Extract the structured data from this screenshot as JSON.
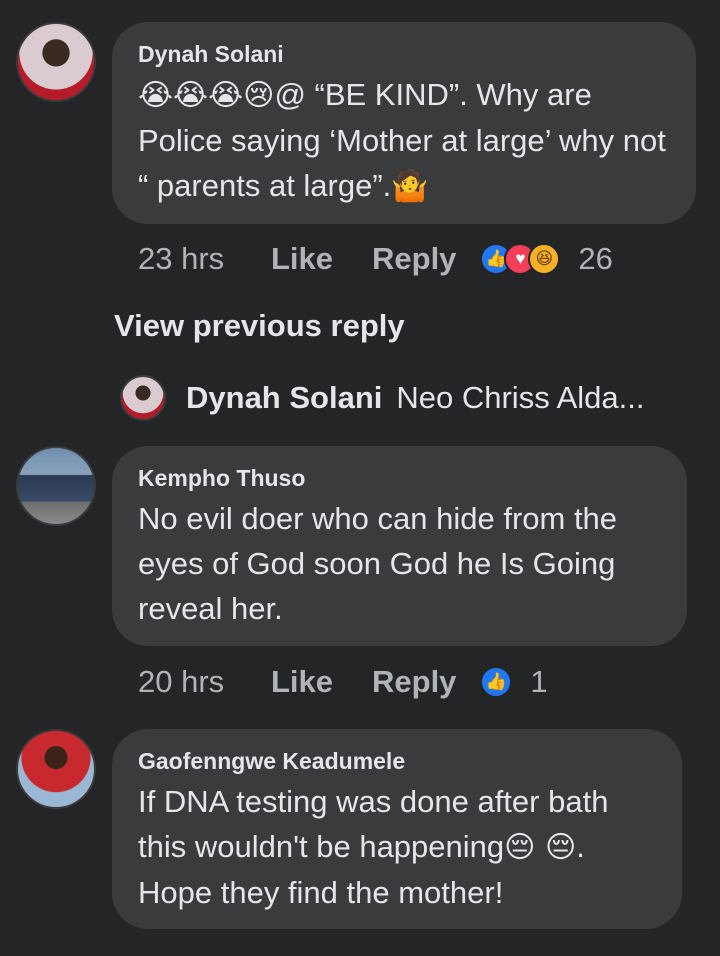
{
  "comments": [
    {
      "author": "Dynah Solani",
      "emojis": "😭😭😭😢",
      "text": "@ “BE KIND”. Why are Police saying  ‘Mother at large’ why not “ parents at large”.",
      "trailing_emoji": "🤷",
      "time": "23 hrs",
      "like_label": "Like",
      "reply_label": "Reply",
      "reaction_count": "26",
      "reactions": [
        "like-icon",
        "love-icon",
        "haha-icon"
      ]
    },
    {
      "author": "Kempho Thuso",
      "text": "No evil doer who can hide from the eyes of God soon God he Is Going reveal her.",
      "time": "20 hrs",
      "like_label": "Like",
      "reply_label": "Reply",
      "reaction_count": "1",
      "reactions": [
        "like-icon"
      ]
    },
    {
      "author": "Gaofenngwe Keadumele",
      "text_line1": "If DNA testing was done after bath this wouldn't be happening",
      "emojis": "😔 😔",
      "text_line2": ". Hope they find the mother!",
      "time": "",
      "reaction_count": ""
    }
  ],
  "view_previous_reply": "View previous reply",
  "reply_preview": {
    "author": "Dynah Solani",
    "snippet": "Neo Chriss Alda..."
  },
  "colors": {
    "background": "#242526",
    "bubble": "#3a3b3c",
    "text": "#e4e6eb",
    "secondary": "#b0b3b8",
    "like_blue": "#2078f4",
    "love_red": "#f33e58"
  }
}
